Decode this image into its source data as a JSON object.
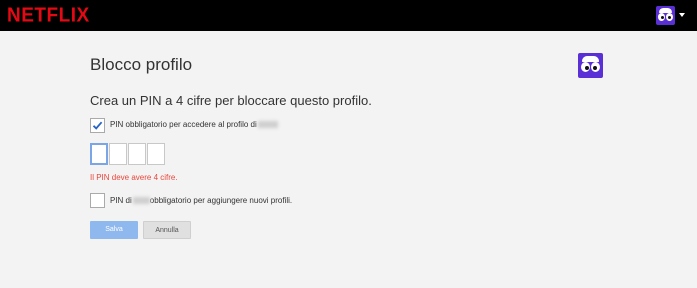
{
  "header": {
    "logo_text": "NETFLIX",
    "profile_icon": "kids-profile-avatar-icon",
    "menu_caret_icon": "caret-down-icon"
  },
  "page": {
    "title": "Blocco profilo",
    "subtitle": "Crea un PIN a 4 cifre per bloccare questo profilo."
  },
  "options": {
    "require_pin_label": "PIN obbligatorio per accedere al profilo di",
    "require_pin_checked": true,
    "add_profiles_label_prefix": "PIN di",
    "add_profiles_label_suffix": "obbligatorio per aggiungere nuovi profili.",
    "add_profiles_checked": false
  },
  "pin": {
    "digits": [
      "",
      "",
      "",
      ""
    ],
    "error": "Il PIN deve avere 4 cifre."
  },
  "buttons": {
    "save_label": "Salva",
    "cancel_label": "Annulla"
  },
  "colors": {
    "brand": "#e50914",
    "avatar": "#5b2fd6",
    "error": "#e8463c",
    "save_button": "#8fb8ef"
  }
}
